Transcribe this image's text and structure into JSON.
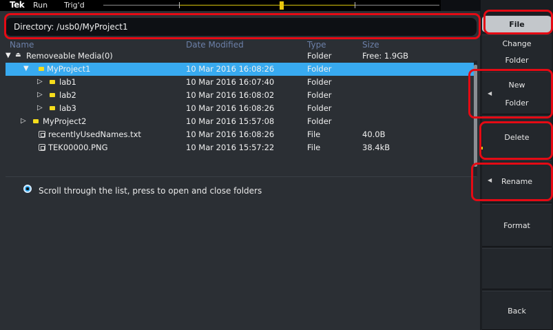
{
  "topbar": {
    "logo": "Tek",
    "run_state": "Run",
    "trigger_state": "Trig'd"
  },
  "directory": {
    "label": "Directory: /usb0/MyProject1"
  },
  "columns": {
    "name": "Name",
    "date_modified": "Date Modified",
    "type": "Type",
    "size": "Size"
  },
  "rows": [
    {
      "name": "Removeable Media(0)",
      "date": "",
      "type": "Folder",
      "size": "Free: 1.9GB"
    },
    {
      "name": "MyProject1",
      "date": "10 Mar 2016 16:08:26",
      "type": "Folder",
      "size": ""
    },
    {
      "name": "lab1",
      "date": "10 Mar 2016 16:07:40",
      "type": "Folder",
      "size": ""
    },
    {
      "name": "lab2",
      "date": "10 Mar 2016 16:08:02",
      "type": "Folder",
      "size": ""
    },
    {
      "name": "lab3",
      "date": "10 Mar 2016 16:08:26",
      "type": "Folder",
      "size": ""
    },
    {
      "name": "MyProject2",
      "date": "10 Mar 2016 15:57:08",
      "type": "Folder",
      "size": ""
    },
    {
      "name": "recentlyUsedNames.txt",
      "date": "10 Mar 2016 16:08:26",
      "type": "File",
      "size": "40.0B"
    },
    {
      "name": "TEK00000.PNG",
      "date": "10 Mar 2016 15:57:22",
      "type": "File",
      "size": "38.4kB"
    }
  ],
  "hint": {
    "text": "Scroll through the list, press to open and close folders"
  },
  "side_menu": {
    "file": "File",
    "change_line1": "Change",
    "change_line2": "Folder",
    "new_line1": "New",
    "new_line2": "Folder",
    "delete": "Delete",
    "rename": "Rename",
    "format": "Format",
    "back": "Back"
  },
  "colors": {
    "selection": "#38aaf0",
    "panel": "#2b2f34",
    "annotation": "#e50a14",
    "folder_icon": "#f5dc1c"
  }
}
